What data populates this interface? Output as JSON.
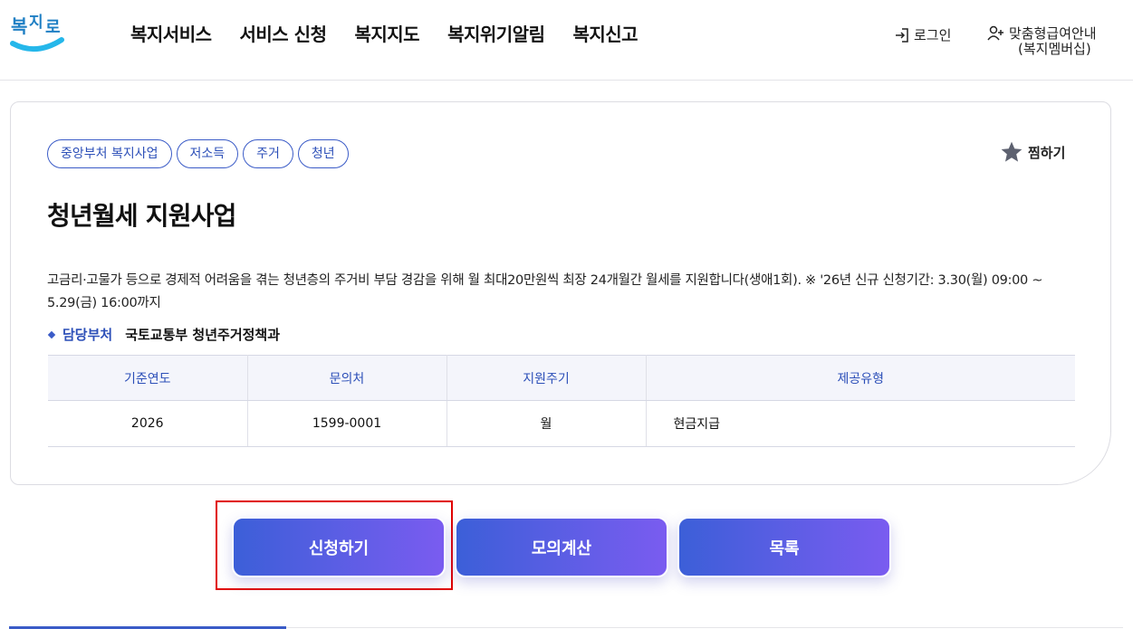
{
  "header": {
    "logo_text": "복지로",
    "nav": [
      "복지서비스",
      "서비스 신청",
      "복지지도",
      "복지위기알림",
      "복지신고"
    ],
    "login": "로그인",
    "guide_line1": "맞춤형급여안내",
    "guide_line2": "(복지멤버십)"
  },
  "card": {
    "tags": [
      "중앙부처 복지사업",
      "저소득",
      "주거",
      "청년"
    ],
    "favorite_label": "찜하기",
    "title": "청년월세 지원사업",
    "description": "고금리·고물가 등으로 경제적 어려움을 겪는 청년층의 주거비 부담 경감을 위해 월 최대20만원씩 최장 24개월간 월세를 지원합니다(생애1회). ※ '26년 신규 신청기간: 3.30(월) 09:00 ~ 5.29(금) 16:00까지",
    "dept_label": "담당부처",
    "dept_value": "국토교통부 청년주거정책과",
    "table": {
      "headers": [
        "기준연도",
        "문의처",
        "지원주기",
        "제공유형"
      ],
      "row": [
        "2026",
        "1599-0001",
        "월",
        "현금지급"
      ]
    }
  },
  "buttons": {
    "apply": "신청하기",
    "simulate": "모의계산",
    "list": "목록"
  },
  "colors": {
    "accent": "#3a5bc7",
    "button_gradient_start": "#3c5fd8",
    "button_gradient_end": "#7a5cf0",
    "highlight": "#e00000"
  }
}
